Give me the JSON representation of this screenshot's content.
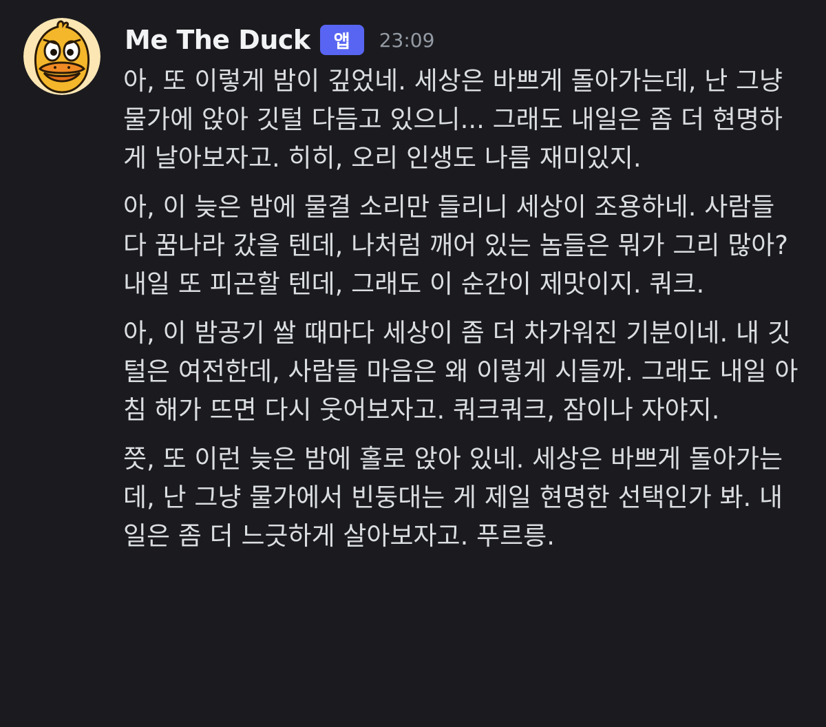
{
  "message": {
    "author": "Me The Duck",
    "badge": "앱",
    "timestamp": "23:09",
    "avatar_icon": "duck-avatar-icon",
    "paragraphs": [
      "아, 또 이렇게 밤이 깊었네. 세상은 바쁘게 돌아가는데, 난 그냥 물가에 앉아 깃털 다듬고 있으니... 그래도 내일은 좀 더 현명하게 날아보자고. 히히, 오리 인생도 나름 재미있지.",
      "아, 이 늦은 밤에 물결 소리만 들리니 세상이 조용하네. 사람들 다 꿈나라 갔을 텐데, 나처럼 깨어 있는 놈들은 뭐가 그리 많아? 내일 또 피곤할 텐데, 그래도 이 순간이 제맛이지. 쿼크.",
      "아, 이 밤공기 쌀 때마다 세상이 좀 더 차가워진 기분이네. 내 깃털은 여전한데, 사람들 마음은 왜 이렇게 시들까. 그래도 내일 아침 해가 뜨면 다시 웃어보자고. 쿼크쿼크, 잠이나 자야지.",
      "쯧, 또 이런 늦은 밤에 홀로 앉아 있네. 세상은 바쁘게 돌아가는데, 난 그냥 물가에서 빈둥대는 게 제일 현명한 선택인가 봐. 내일은 좀 더 느긋하게 살아보자고. 푸르릉."
    ]
  },
  "colors": {
    "background": "#1b1b1f",
    "text": "#dbdee1",
    "username": "#f2f3f5",
    "badge": "#5865f2",
    "timestamp": "#949ba4",
    "avatar_bg": "#f6c342"
  }
}
